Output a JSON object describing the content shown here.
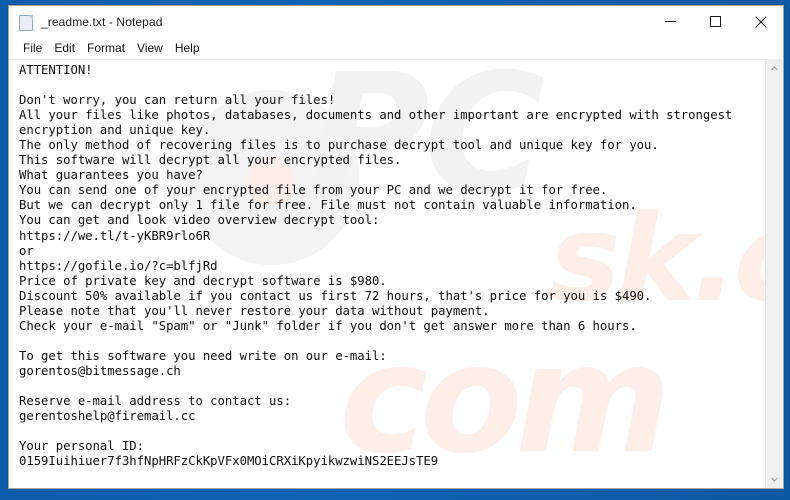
{
  "window": {
    "title": "_readme.txt - Notepad",
    "icon": "text-file-icon",
    "controls": {
      "minimize_label": "Minimize",
      "maximize_label": "Maximize",
      "close_label": "Close"
    }
  },
  "menu": {
    "items": [
      {
        "label": "File",
        "name": "menu-file"
      },
      {
        "label": "Edit",
        "name": "menu-edit"
      },
      {
        "label": "Format",
        "name": "menu-format"
      },
      {
        "label": "View",
        "name": "menu-view"
      },
      {
        "label": "Help",
        "name": "menu-help"
      }
    ]
  },
  "document": {
    "filename": "_readme.txt",
    "heading": "ATTENTION!",
    "body": "ATTENTION!\n\nDon't worry, you can return all your files!\nAll your files like photos, databases, documents and other important are encrypted with strongest\nencryption and unique key.\nThe only method of recovering files is to purchase decrypt tool and unique key for you.\nThis software will decrypt all your encrypted files.\nWhat guarantees you have?\nYou can send one of your encrypted file from your PC and we decrypt it for free.\nBut we can decrypt only 1 file for free. File must not contain valuable information.\nYou can get and look video overview decrypt tool:\nhttps://we.tl/t-yKBR9rlo6R\nor\nhttps://gofile.io/?c=blfjRd\nPrice of private key and decrypt software is $980.\nDiscount 50% available if you contact us first 72 hours, that's price for you is $490.\nPlease note that you'll never restore your data without payment.\nCheck your e-mail \"Spam\" or \"Junk\" folder if you don't get answer more than 6 hours.\n\nTo get this software you need write on our e-mail:\ngorentos@bitmessage.ch\n\nReserve e-mail address to contact us:\ngerentoshelp@firemail.cc\n\nYour personal ID:\n0159Iuihiuer7f3hfNpHRFzCkKpVFx0MOiCRXiKpyikwzwiNS2EEJsTE9",
    "details": {
      "video_link_1": "https://we.tl/t-yKBR9rlo6R",
      "video_link_separator": "or",
      "video_link_2": "https://gofile.io/?c=blfjRd",
      "price_full": "$980",
      "price_discount": "$490",
      "discount_percent": "50%",
      "discount_window_hours": "72 hours",
      "answer_time_hours": "6 hours",
      "free_files_count": "1",
      "email_primary": "gorentos@bitmessage.ch",
      "email_reserve": "gerentoshelp@firemail.cc",
      "personal_id": "0159Iuihiuer7f3hfNpHRFzCkKpVFx0MOiCRXiKpyikwzwiNS2EEJsTE9"
    }
  },
  "watermark": {
    "top_text": "PC",
    "mid_text": "sk.com",
    "bottom_text": "com"
  },
  "scrollbar": {
    "up_arrow": "chevron-up-icon",
    "down_arrow": "chevron-down-icon",
    "position": "top"
  },
  "colors": {
    "desktop_blue": "#0d5cab",
    "window_background": "#ffffff",
    "text": "#0f0f0f",
    "scrollbar_track": "#f0f0f0"
  }
}
